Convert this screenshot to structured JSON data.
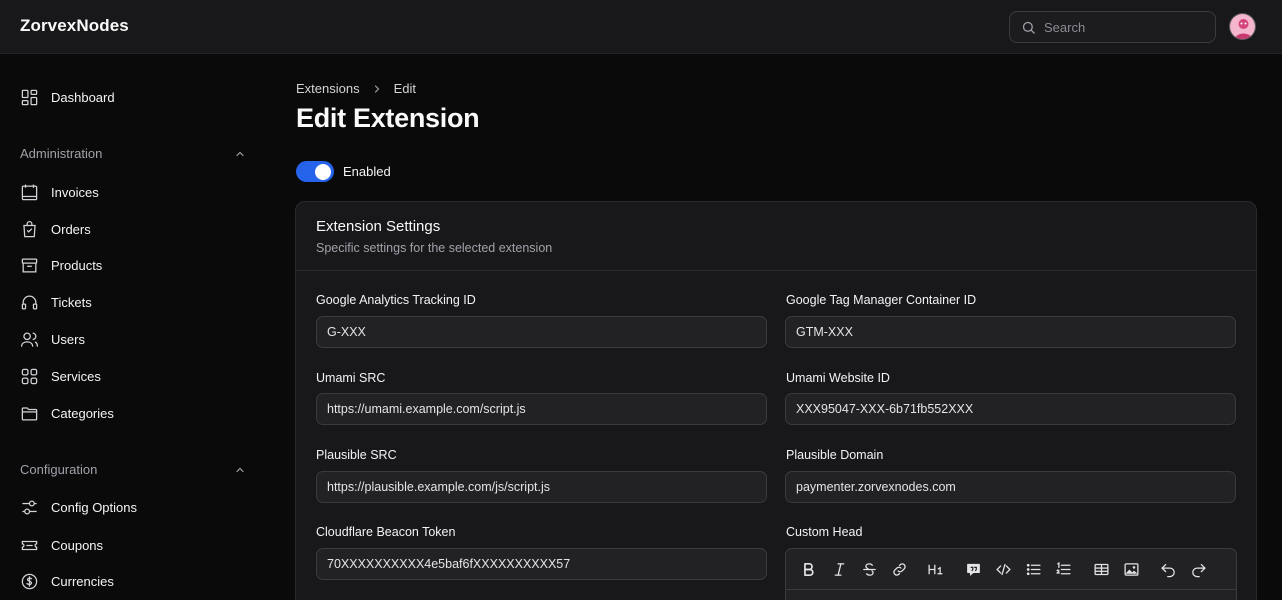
{
  "header": {
    "brand": "ZorvexNodes",
    "search_placeholder": "Search"
  },
  "sidebar": {
    "top_items": [
      {
        "label": "Dashboard",
        "icon": "dashboard-icon"
      }
    ],
    "sections": [
      {
        "title": "Administration",
        "items": [
          {
            "label": "Invoices",
            "icon": "invoice-icon"
          },
          {
            "label": "Orders",
            "icon": "bag-icon"
          },
          {
            "label": "Products",
            "icon": "box-icon"
          },
          {
            "label": "Tickets",
            "icon": "headset-icon"
          },
          {
            "label": "Users",
            "icon": "users-icon"
          },
          {
            "label": "Services",
            "icon": "grid-icon"
          },
          {
            "label": "Categories",
            "icon": "folder-icon"
          }
        ]
      },
      {
        "title": "Configuration",
        "items": [
          {
            "label": "Config Options",
            "icon": "sliders-icon"
          },
          {
            "label": "Coupons",
            "icon": "ticket-icon"
          },
          {
            "label": "Currencies",
            "icon": "currency-icon"
          }
        ]
      }
    ]
  },
  "breadcrumb": [
    "Extensions",
    "Edit"
  ],
  "page_title": "Edit Extension",
  "toggle": {
    "label": "Enabled",
    "on": true
  },
  "card": {
    "title": "Extension Settings",
    "subtitle": "Specific settings for the selected extension",
    "fields": [
      {
        "label": "Google Analytics Tracking ID",
        "value": "G-XXX"
      },
      {
        "label": "Google Tag Manager Container ID",
        "value": "GTM-XXX"
      },
      {
        "label": "Umami SRC",
        "value": "https://umami.example.com/script.js"
      },
      {
        "label": "Umami Website ID",
        "value": "XXX95047-XXX-6b71fb552XXX"
      },
      {
        "label": "Plausible SRC",
        "value": "https://plausible.example.com/js/script.js"
      },
      {
        "label": "Plausible Domain",
        "value": "paymenter.zorvexnodes.com"
      },
      {
        "label": "Cloudflare Beacon Token",
        "value": "70XXXXXXXXXX4e5baf6fXXXXXXXXXX57"
      },
      {
        "label": "Custom Head"
      }
    ]
  },
  "colors": {
    "accent": "#2563eb",
    "background": "#0a0a0b",
    "panel": "#18181b"
  }
}
